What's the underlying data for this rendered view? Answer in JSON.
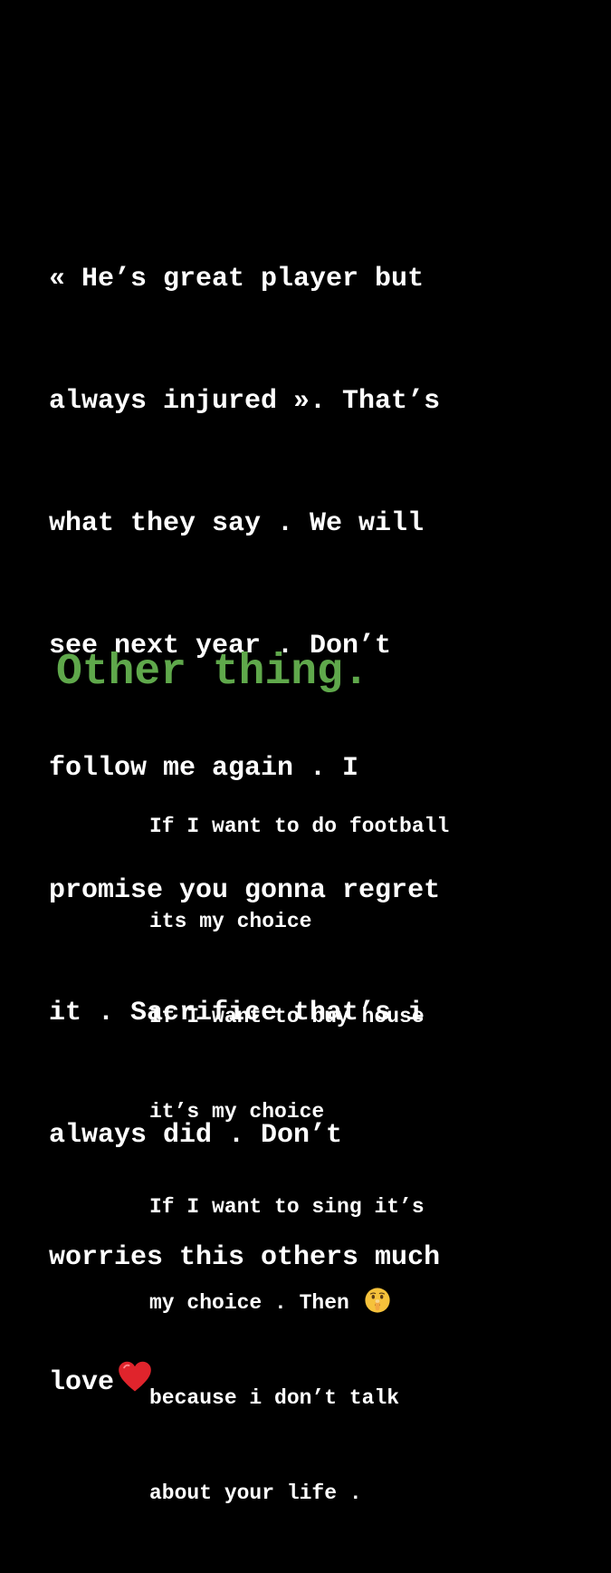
{
  "story": {
    "main_lines": [
      "« He’s great player but",
      "always injured ». That’s",
      "what they say . We will",
      "see next year . Don’t",
      "follow me again . I",
      "promise you gonna regret",
      "it . Sacrifice that’s i",
      "always did . Don’t",
      "worries this others much",
      "love"
    ],
    "heart_emoji": "heart-emoji",
    "heading": "Other thing.",
    "heading_color": "#5fa84b",
    "sub_lines": [
      "If I want to do football",
      "its my choice",
      "If I want to buy house",
      "it’s my choice",
      "If I want to sing it’s",
      "my choice . Then",
      "because i don’t talk",
      "about your life ."
    ],
    "shush_emoji": "shushing-face-emoji",
    "background_color": "#000000",
    "text_color": "#ffffff"
  }
}
